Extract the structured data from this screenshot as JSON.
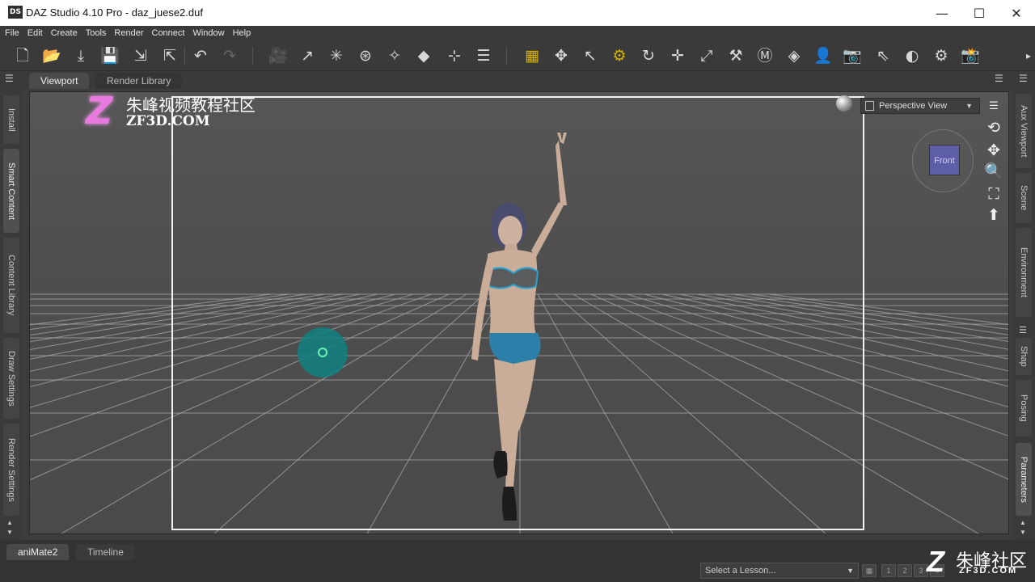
{
  "window": {
    "title": "DAZ Studio 4.10 Pro - daz_juese2.duf",
    "app_icon_text": "DS",
    "controls": {
      "minimize": "—",
      "maximize": "☐",
      "close": "✕"
    }
  },
  "menu": [
    "File",
    "Edit",
    "Create",
    "Tools",
    "Render",
    "Connect",
    "Window",
    "Help"
  ],
  "tabs": {
    "viewport": "Viewport",
    "render_library": "Render Library"
  },
  "left_panes": [
    "Install",
    "Smart Content",
    "Content Library",
    "Draw Settings",
    "Render Settings"
  ],
  "right_panes": [
    "Aux Viewport",
    "Scene",
    "Environment",
    "Shap",
    "Posing",
    "Parameters"
  ],
  "viewport": {
    "camera": "Perspective View",
    "view_cube_label": "Front"
  },
  "watermark": {
    "chinese": "朱峰视频教程社区",
    "url": "ZF3D.COM",
    "logo_letter": "Z"
  },
  "bottom": {
    "tabs": {
      "animate": "aniMate2",
      "timeline": "Timeline"
    },
    "lesson_placeholder": "Select a Lesson...",
    "pages": [
      "1",
      "2",
      "3",
      "4"
    ]
  },
  "corner_watermark": {
    "letter": "Z",
    "chinese": "朱峰社区",
    "url": "ZF3D.COM"
  }
}
